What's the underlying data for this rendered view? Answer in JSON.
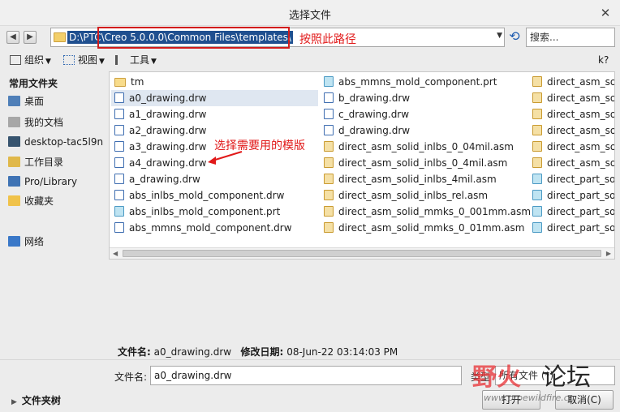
{
  "window": {
    "title": "选择文件",
    "close_glyph": "✕"
  },
  "nav": {
    "back_glyph": "◀",
    "forward_glyph": "▶",
    "refresh_glyph": "⟲"
  },
  "address": {
    "path": "D:\\PTC\\Creo 5.0.0.0\\Common Files\\templates\\",
    "dropdown_glyph": "▼"
  },
  "search": {
    "placeholder": "搜索..."
  },
  "annotations": {
    "path_note": "按照此路径",
    "select_note": "选择需要用的模版"
  },
  "toolbar": {
    "organize": "组织",
    "view": "视图",
    "tools": "工具",
    "help_glyph": "k?"
  },
  "sidebar": {
    "heading": "常用文件夹",
    "items": [
      {
        "label": "桌面",
        "icon": "desktop-icon",
        "color": "#4f7fb8"
      },
      {
        "label": "我的文档",
        "icon": "documents-icon",
        "color": "#a7a7a7"
      },
      {
        "label": "desktop-tac5l9n",
        "icon": "computer-icon",
        "color": "#37546f"
      },
      {
        "label": "工作目录",
        "icon": "working-directory-icon",
        "color": "#e0b84a"
      },
      {
        "label": "Pro/Library",
        "icon": "library-icon",
        "color": "#3f73b4"
      },
      {
        "label": "收藏夹",
        "icon": "favorites-icon",
        "color": "#f0c24a"
      },
      {
        "label": "网络",
        "icon": "network-icon",
        "color": "#3a78c8"
      }
    ]
  },
  "files": {
    "columns": [
      [
        {
          "name": "tm",
          "type": "folder"
        },
        {
          "name": "a0_drawing.drw",
          "type": "drw",
          "selected": true
        },
        {
          "name": "a1_drawing.drw",
          "type": "drw"
        },
        {
          "name": "a2_drawing.drw",
          "type": "drw"
        },
        {
          "name": "a3_drawing.drw",
          "type": "drw"
        },
        {
          "name": "a4_drawing.drw",
          "type": "drw"
        },
        {
          "name": "a_drawing.drw",
          "type": "drw"
        },
        {
          "name": "abs_inlbs_mold_component.drw",
          "type": "drw"
        },
        {
          "name": "abs_inlbs_mold_component.prt",
          "type": "prt"
        },
        {
          "name": "abs_mmns_mold_component.drw",
          "type": "drw"
        }
      ],
      [
        {
          "name": "abs_mmns_mold_component.prt",
          "type": "prt"
        },
        {
          "name": "b_drawing.drw",
          "type": "drw"
        },
        {
          "name": "c_drawing.drw",
          "type": "drw"
        },
        {
          "name": "d_drawing.drw",
          "type": "drw"
        },
        {
          "name": "direct_asm_solid_inlbs_0_04mil.asm",
          "type": "asm"
        },
        {
          "name": "direct_asm_solid_inlbs_0_4mil.asm",
          "type": "asm"
        },
        {
          "name": "direct_asm_solid_inlbs_4mil.asm",
          "type": "asm"
        },
        {
          "name": "direct_asm_solid_inlbs_rel.asm",
          "type": "asm"
        },
        {
          "name": "direct_asm_solid_mmks_0_001mm.asm",
          "type": "asm"
        },
        {
          "name": "direct_asm_solid_mmks_0_01mm.asm",
          "type": "asm"
        }
      ],
      [
        {
          "name": "direct_asm_so",
          "type": "asm"
        },
        {
          "name": "direct_asm_so",
          "type": "asm"
        },
        {
          "name": "direct_asm_so",
          "type": "asm"
        },
        {
          "name": "direct_asm_so",
          "type": "asm"
        },
        {
          "name": "direct_asm_so",
          "type": "asm"
        },
        {
          "name": "direct_asm_so",
          "type": "asm"
        },
        {
          "name": "direct_part_so",
          "type": "prt"
        },
        {
          "name": "direct_part_so",
          "type": "prt"
        },
        {
          "name": "direct_part_so",
          "type": "prt"
        },
        {
          "name": "direct_part_so",
          "type": "prt"
        }
      ]
    ]
  },
  "scrollbar": {
    "left_glyph": "◀",
    "right_glyph": "▶"
  },
  "info": {
    "filename_label": "文件名:",
    "filename_value": "a0_drawing.drw",
    "modified_label": "修改日期:",
    "modified_value": "08-Jun-22 03:14:03 PM"
  },
  "filename_field": {
    "label": "文件名:",
    "value": "a0_drawing.drw"
  },
  "type_field": {
    "label": "类型",
    "value": "所有文件 (*)"
  },
  "folder_tree": {
    "label": "文件夹树",
    "glyph": "▶"
  },
  "buttons": {
    "open": "打开",
    "cancel": "取消(C)"
  },
  "watermark": {
    "text_red": "野火",
    "text_black": "论坛",
    "url": "www.proewildfire.cn"
  }
}
